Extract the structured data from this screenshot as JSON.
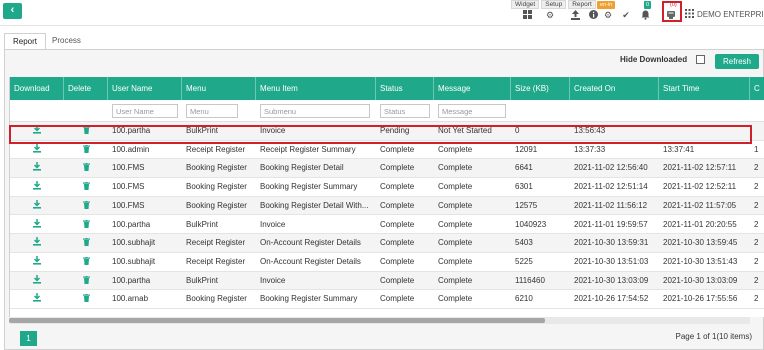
{
  "topbar": {
    "back_icon": "chevron-left-icon",
    "links": [
      "Widget",
      "Setup",
      "Report"
    ],
    "orange_badge": "en-in",
    "green_badge": "0",
    "red_badge": "(0)",
    "company": "DEMO ENTERPRISE"
  },
  "tabs": [
    "Report",
    "Process"
  ],
  "toolbar": {
    "hide_downloaded_label": "Hide Downloaded",
    "hide_downloaded_checked": false,
    "refresh_label": "Refresh"
  },
  "grid": {
    "columns": [
      "Download",
      "Delete",
      "User Name",
      "Menu",
      "Menu Item",
      "Status",
      "Message",
      "Size (KB)",
      "Created On",
      "Start Time",
      "C"
    ],
    "filters": {
      "user_name": "User Name",
      "menu": "Menu",
      "submenu": "Submenu",
      "status": "Status",
      "message": "Message"
    },
    "rows": [
      {
        "user": "100.partha",
        "menu": "BulkPrint",
        "item": "Invoice",
        "status": "Pending",
        "message": "Not Yet Started",
        "size": "0",
        "created": "13:56:43",
        "start": "",
        "c": "",
        "highlighted": true
      },
      {
        "user": "100.admin",
        "menu": "Receipt Register",
        "item": "Receipt Register Summary",
        "status": "Complete",
        "message": "Complete",
        "size": "12091",
        "created": "13:37:33",
        "start": "13:37:41",
        "c": "1"
      },
      {
        "user": "100.FMS",
        "menu": "Booking Register",
        "item": "Booking Register Detail",
        "status": "Complete",
        "message": "Complete",
        "size": "6641",
        "created": "2021-11-02 12:56:40",
        "start": "2021-11-02 12:57:11",
        "c": "2"
      },
      {
        "user": "100.FMS",
        "menu": "Booking Register",
        "item": "Booking Register Summary",
        "status": "Complete",
        "message": "Complete",
        "size": "6301",
        "created": "2021-11-02 12:51:14",
        "start": "2021-11-02 12:52:11",
        "c": "2"
      },
      {
        "user": "100.FMS",
        "menu": "Booking Register",
        "item": "Booking Register Detail With...",
        "status": "Complete",
        "message": "Complete",
        "size": "12575",
        "created": "2021-11-02 11:56:12",
        "start": "2021-11-02 11:57:05",
        "c": "2"
      },
      {
        "user": "100.partha",
        "menu": "BulkPrint",
        "item": "Invoice",
        "status": "Complete",
        "message": "Complete",
        "size": "1040923",
        "created": "2021-11-01 19:59:57",
        "start": "2021-11-01 20:20:55",
        "c": "2"
      },
      {
        "user": "100.subhajit",
        "menu": "Receipt Register",
        "item": "On-Account Register Details",
        "status": "Complete",
        "message": "Complete",
        "size": "5403",
        "created": "2021-10-30 13:59:31",
        "start": "2021-10-30 13:59:45",
        "c": "2"
      },
      {
        "user": "100.subhajit",
        "menu": "Receipt Register",
        "item": "On-Account Register Details",
        "status": "Complete",
        "message": "Complete",
        "size": "5225",
        "created": "2021-10-30 13:51:03",
        "start": "2021-10-30 13:51:43",
        "c": "2"
      },
      {
        "user": "100.partha",
        "menu": "BulkPrint",
        "item": "Invoice",
        "status": "Complete",
        "message": "Complete",
        "size": "1116460",
        "created": "2021-10-30 13:03:09",
        "start": "2021-10-30 13:03:09",
        "c": "2"
      },
      {
        "user": "100.arnab",
        "menu": "Booking Register",
        "item": "Booking Register Summary",
        "status": "Complete",
        "message": "Complete",
        "size": "6210",
        "created": "2021-10-26 17:54:52",
        "start": "2021-10-26 17:55:56",
        "c": "2"
      }
    ]
  },
  "footer": {
    "current_page": "1",
    "page_info": "Page 1 of 1(10 items)"
  },
  "colors": {
    "accent": "#1fa98a",
    "highlight": "#d0202a",
    "badge_orange": "#f0a030"
  }
}
